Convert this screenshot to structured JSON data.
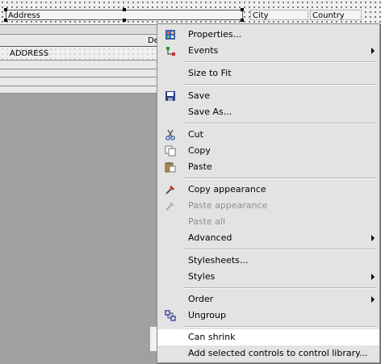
{
  "designer": {
    "controls": {
      "address": "Address",
      "city": "City",
      "country": "Country"
    },
    "band_fragment": "De",
    "address_field": "ADDRESS"
  },
  "context_menu": {
    "items": [
      {
        "label": "Properties...",
        "icon": "properties-icon",
        "submenu": false,
        "enabled": true
      },
      {
        "label": "Events",
        "icon": "events-icon",
        "submenu": true,
        "enabled": true
      },
      {
        "label": "Size to Fit",
        "icon": "",
        "submenu": false,
        "enabled": true
      },
      {
        "label": "Save",
        "icon": "save-icon",
        "submenu": false,
        "enabled": true
      },
      {
        "label": "Save As...",
        "icon": "",
        "submenu": false,
        "enabled": true
      },
      {
        "label": "Cut",
        "icon": "cut-icon",
        "submenu": false,
        "enabled": true
      },
      {
        "label": "Copy",
        "icon": "copy-icon",
        "submenu": false,
        "enabled": true
      },
      {
        "label": "Paste",
        "icon": "paste-icon",
        "submenu": false,
        "enabled": true
      },
      {
        "label": "Copy appearance",
        "icon": "copy-appearance-icon",
        "submenu": false,
        "enabled": true
      },
      {
        "label": "Paste appearance",
        "icon": "paste-appearance-icon",
        "submenu": false,
        "enabled": false
      },
      {
        "label": "Paste all",
        "icon": "",
        "submenu": false,
        "enabled": false
      },
      {
        "label": "Advanced",
        "icon": "",
        "submenu": true,
        "enabled": true
      },
      {
        "label": "Stylesheets...",
        "icon": "",
        "submenu": false,
        "enabled": true
      },
      {
        "label": "Styles",
        "icon": "",
        "submenu": true,
        "enabled": true
      },
      {
        "label": "Order",
        "icon": "",
        "submenu": true,
        "enabled": true
      },
      {
        "label": "Ungroup",
        "icon": "ungroup-icon",
        "submenu": false,
        "enabled": true
      },
      {
        "label": "Can shrink",
        "icon": "",
        "submenu": false,
        "enabled": true,
        "highlighted": true
      },
      {
        "label": "Add selected controls to control library...",
        "icon": "",
        "submenu": false,
        "enabled": true
      }
    ]
  },
  "colors": {
    "menu_bg": "#e3e3e3",
    "highlight": "#ffffff",
    "workspace": "#a0a0a0",
    "disabled_text": "#8f8f8f"
  }
}
